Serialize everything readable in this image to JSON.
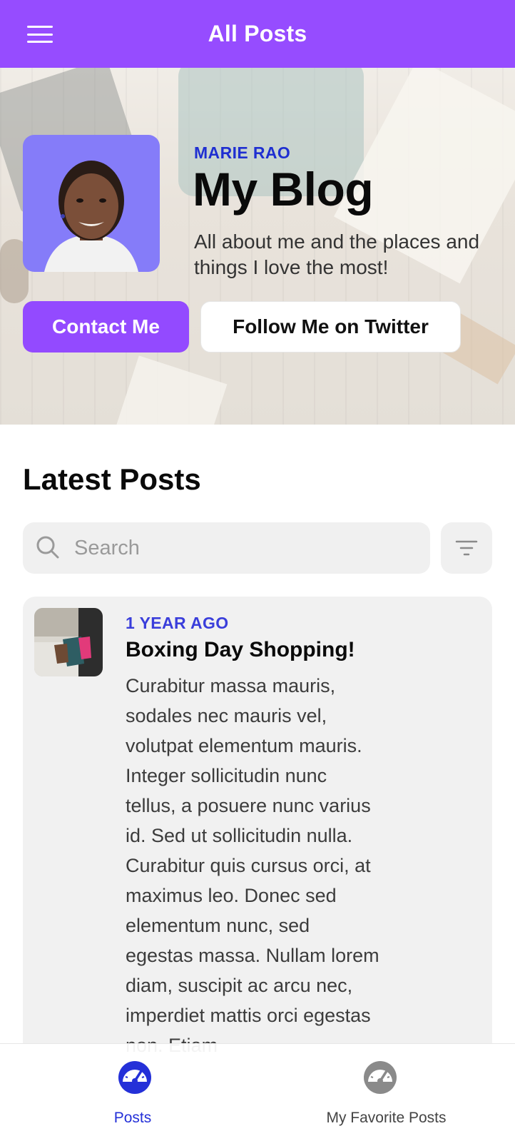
{
  "app_bar": {
    "title": "All Posts",
    "menu_icon": "hamburger-menu-icon"
  },
  "hero": {
    "author": "MARIE RAO",
    "blog_title": "My Blog",
    "tagline": "All about me and the places and things I love the most!",
    "contact_button": "Contact Me",
    "follow_button": "Follow Me on Twitter",
    "colors": {
      "accent": "#934AFF",
      "author": "#1F2FD1",
      "avatar_bg": "#857CF9"
    }
  },
  "latest": {
    "title": "Latest Posts",
    "search_placeholder": "Search",
    "search_value": "",
    "filter_icon": "filter-icon"
  },
  "posts": [
    {
      "age": "1 YEAR AGO",
      "title": "Boxing Day Shopping!",
      "excerpt": "Curabitur massa mauris, sodales nec mauris vel, volutpat elementum mauris. Integer sollicitudin nunc tellus, a posuere nunc varius id. Sed ut sollicitudin nulla. Curabitur quis cursus orci, at maximus leo. Donec sed elementum nunc, sed egestas massa. Nullam lorem diam, suscipit ac arcu nec, imperdiet mattis orci egestas non. Etiam"
    }
  ],
  "bottom_nav": {
    "items": [
      {
        "label": "Posts",
        "icon": "speedometer-icon",
        "active": true
      },
      {
        "label": "My Favorite Posts",
        "icon": "speedometer-icon",
        "active": false
      }
    ],
    "colors": {
      "active": "#2430D8",
      "inactive": "#8a8a8a"
    }
  }
}
